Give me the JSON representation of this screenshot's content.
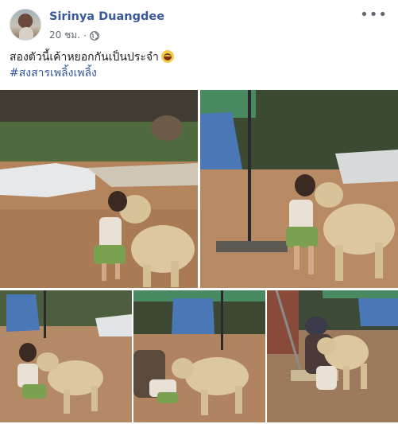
{
  "post": {
    "author": "Sirinya Duangdee",
    "time": "20 ชม.",
    "separator": "·",
    "audience_icon": "globe-icon",
    "more_icon": "more-options-icon",
    "caption": "สองตัวนี้เค้าหยอกกันเป็นประจำ",
    "caption_emoji": "laughing-emoji",
    "hashtag": "#สงสารเพลิ้งเพลิ้ง"
  },
  "photos": {
    "count_shown": 5,
    "subjects": [
      "child",
      "dog"
    ]
  },
  "colors": {
    "link": "#385898",
    "meta": "#616770",
    "text": "#1c1e21",
    "dog": "#d9c49a",
    "ground": "#b0805a"
  }
}
